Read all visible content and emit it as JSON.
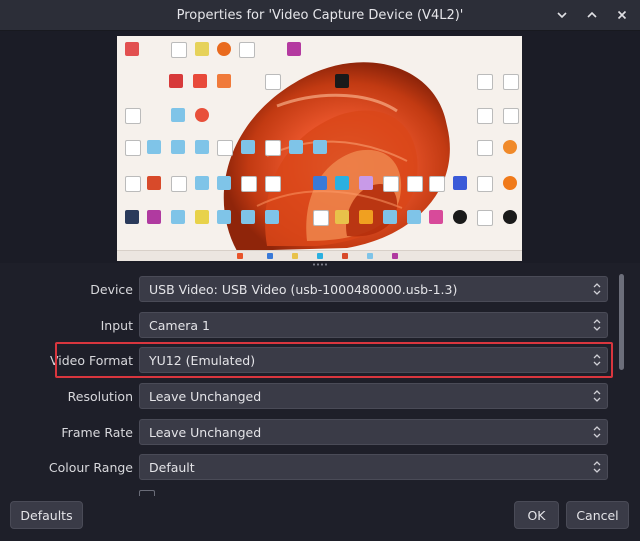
{
  "window": {
    "title": "Properties for 'Video Capture Device (V4L2)'",
    "controls": [
      "minimize-icon",
      "maximize-icon",
      "close-icon"
    ]
  },
  "fields": [
    {
      "label": "Device",
      "value": "USB Video: USB Video (usb-1000480000.usb-1.3)"
    },
    {
      "label": "Input",
      "value": "Camera 1"
    },
    {
      "label": "Video Format",
      "value": "YU12 (Emulated)"
    },
    {
      "label": "Resolution",
      "value": "Leave Unchanged"
    },
    {
      "label": "Frame Rate",
      "value": "Leave Unchanged"
    },
    {
      "label": "Colour Range",
      "value": "Default"
    }
  ],
  "buttons": {
    "defaults": "Defaults",
    "ok": "OK",
    "cancel": "Cancel"
  },
  "colors": {
    "highlight": "#d9363e",
    "accent": "#e8542a"
  }
}
